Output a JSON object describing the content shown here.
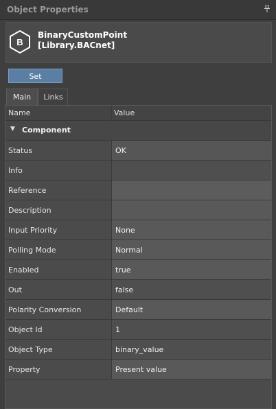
{
  "panel": {
    "title": "Object Properties",
    "pin_glyph": "📌"
  },
  "object": {
    "icon": "bacnet-b-icon",
    "name": "BinaryCustomPoint",
    "library": "[Library.BACnet]"
  },
  "toolbar": {
    "set_label": "Set"
  },
  "tabs": [
    {
      "label": "Main"
    },
    {
      "label": "Links"
    }
  ],
  "grid": {
    "headers": {
      "name": "Name",
      "value": "Value"
    },
    "section": "Component",
    "rows": [
      {
        "name": "Status",
        "value": "OK"
      },
      {
        "name": "Info",
        "value": ""
      },
      {
        "name": "Reference",
        "value": ""
      },
      {
        "name": "Description",
        "value": ""
      },
      {
        "name": "Input Priority",
        "value": "None"
      },
      {
        "name": "Polling Mode",
        "value": "Normal"
      },
      {
        "name": "Enabled",
        "value": "true"
      },
      {
        "name": "Out",
        "value": "false"
      },
      {
        "name": "Polarity Conversion",
        "value": "Default"
      },
      {
        "name": "Object Id",
        "value": "1"
      },
      {
        "name": "Object Type",
        "value": "binary_value"
      },
      {
        "name": "Property",
        "value": "Present value"
      }
    ]
  }
}
